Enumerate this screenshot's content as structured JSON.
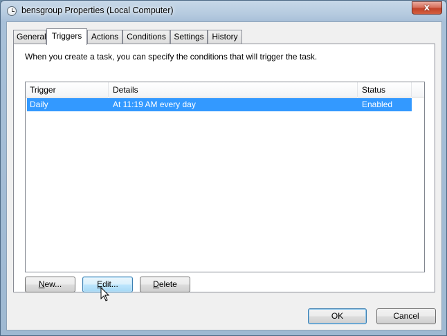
{
  "window": {
    "title": "bensgroup Properties (Local Computer)",
    "title_icon": "clock-icon",
    "close_glyph": "x"
  },
  "tabs": [
    "General",
    "Triggers",
    "Actions",
    "Conditions",
    "Settings",
    "History"
  ],
  "active_tab": "Triggers",
  "panel": {
    "description": "When you create a task, you can specify the conditions that will trigger the task."
  },
  "triggers_list": {
    "columns": [
      "Trigger",
      "Details",
      "Status"
    ],
    "rows": [
      {
        "trigger": "Daily",
        "details": "At 11:19 AM every day",
        "status": "Enabled",
        "selected": true
      }
    ],
    "selection_color": "#3399ff"
  },
  "buttons": {
    "new_accel": "N",
    "new_rest": "ew...",
    "edit_accel": "E",
    "edit_rest": "dit...",
    "delete_accel": "D",
    "delete_rest": "elete",
    "ok": "OK",
    "cancel": "Cancel"
  },
  "cursor_icon": "arrow-pointer-icon"
}
